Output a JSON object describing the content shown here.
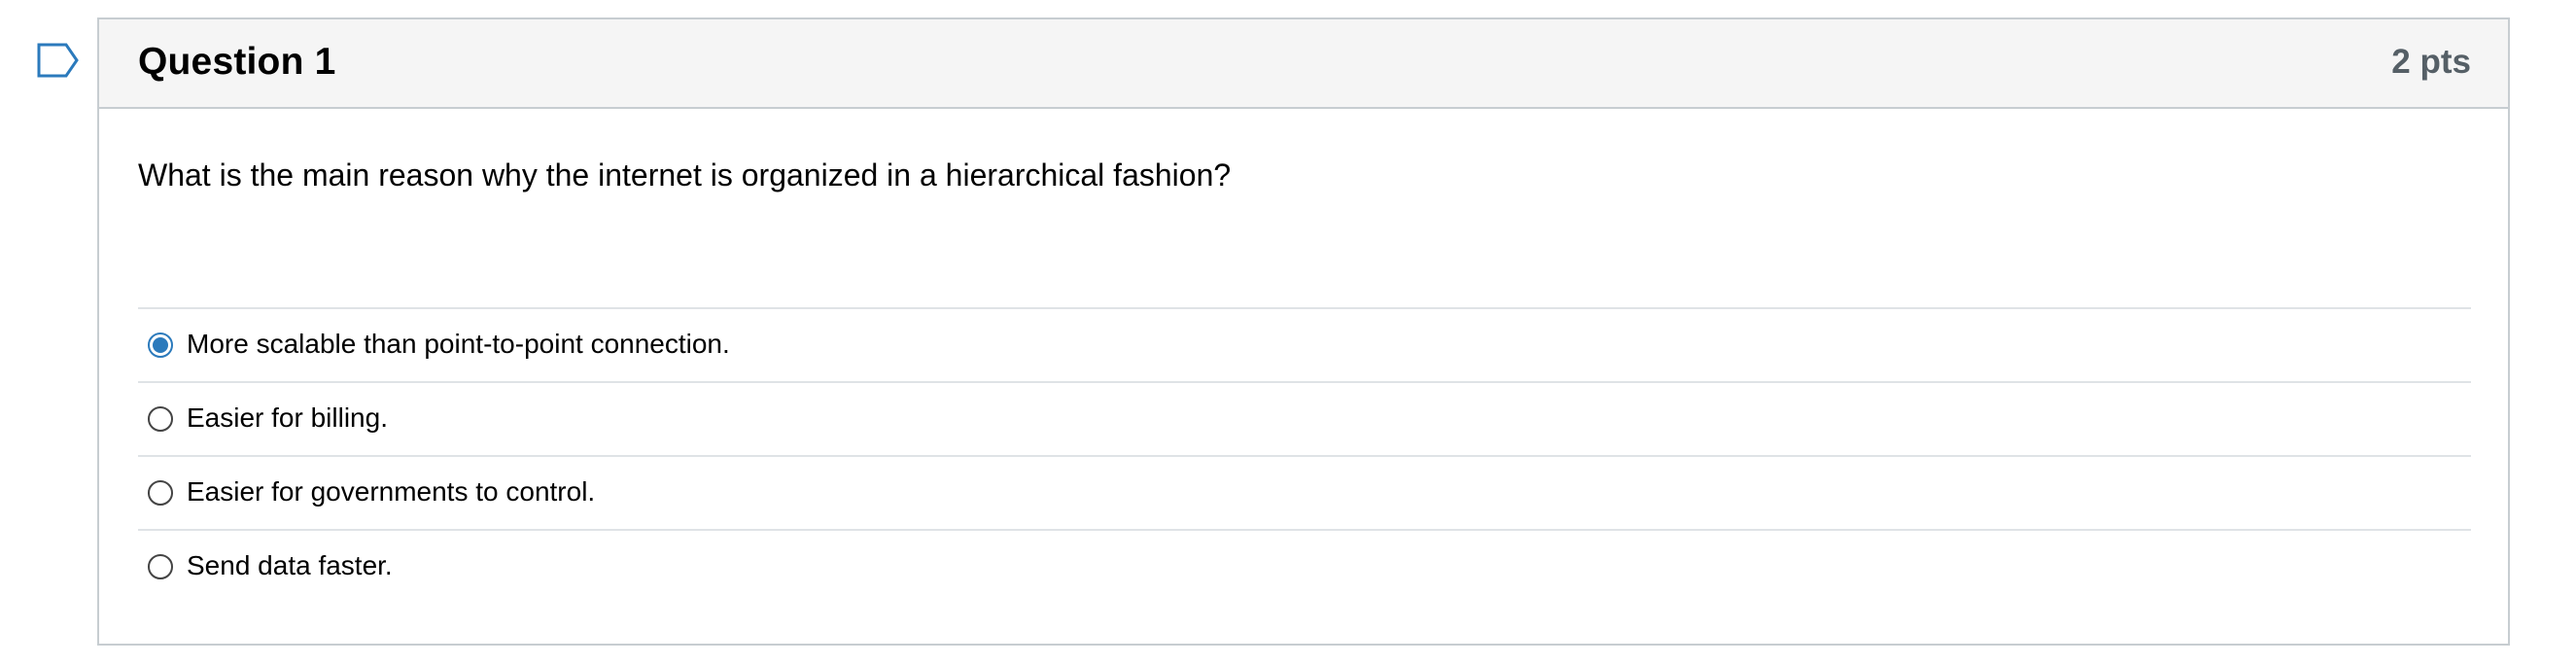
{
  "flag": {
    "icon": "bookmark-flag-icon"
  },
  "question": {
    "title": "Question 1",
    "points": "2 pts",
    "text": "What is the main reason why the internet is organized in a hierarchical fashion?",
    "answers": [
      {
        "label": "More scalable than point-to-point connection.",
        "selected": true
      },
      {
        "label": "Easier for billing.",
        "selected": false
      },
      {
        "label": "Easier for governments to control.",
        "selected": false
      },
      {
        "label": "Send data faster.",
        "selected": false
      }
    ]
  },
  "colors": {
    "accent": "#2b7abc",
    "header_bg": "#f5f5f5",
    "border": "#c7cdd1"
  }
}
